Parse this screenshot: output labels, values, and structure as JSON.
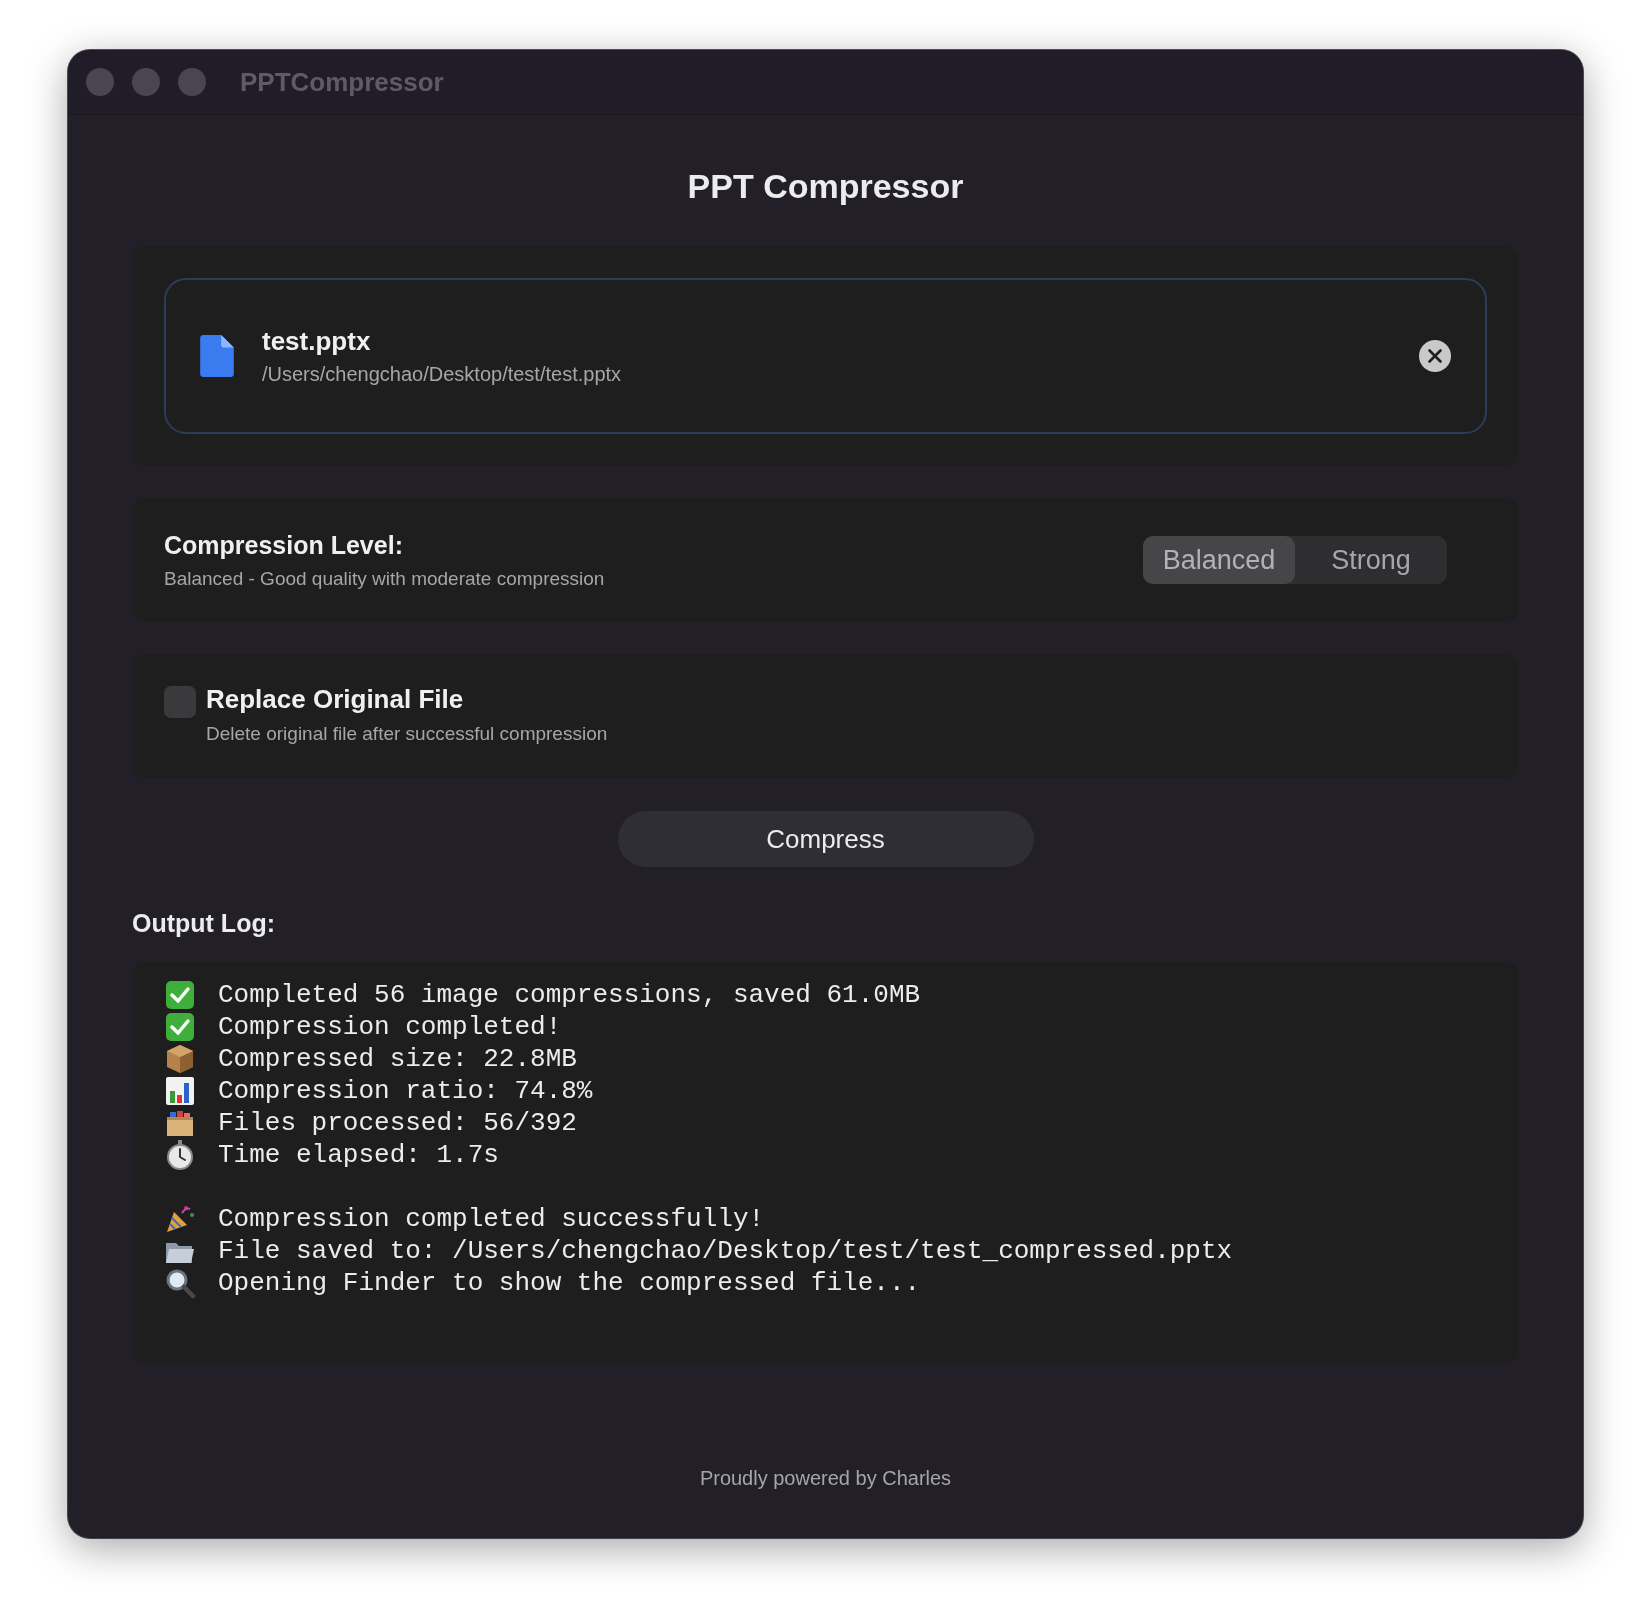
{
  "window": {
    "title": "PPTCompressor"
  },
  "heading": "PPT Compressor",
  "file": {
    "name": "test.pptx",
    "path": "/Users/chengchao/Desktop/test/test.pptx"
  },
  "compression": {
    "label": "Compression Level:",
    "description": "Balanced - Good quality with moderate compression",
    "options": [
      {
        "label": "Balanced",
        "selected": true
      },
      {
        "label": "Strong",
        "selected": false
      }
    ]
  },
  "replace": {
    "label": "Replace Original File",
    "description": "Delete original file after successful compression",
    "checked": false
  },
  "compress_button": "Compress",
  "log": {
    "label": "Output Log:",
    "lines": [
      {
        "kind": "check",
        "text": "Completed 56 image compressions, saved 61.0MB"
      },
      {
        "kind": "check",
        "text": "Compression completed!"
      },
      {
        "kind": "package",
        "text": "Compressed size: 22.8MB"
      },
      {
        "kind": "chart",
        "text": "Compression ratio: 74.8%"
      },
      {
        "kind": "cardbox",
        "text": "Files processed: 56/392"
      },
      {
        "kind": "stopwatch",
        "text": "Time elapsed: 1.7s"
      },
      {
        "kind": "party",
        "text": "Compression completed successfully!",
        "gap_before": true
      },
      {
        "kind": "folder",
        "text": "File saved to: /Users/chengchao/Desktop/test/test_compressed.pptx"
      },
      {
        "kind": "magnifier",
        "text": "Opening Finder to show the compressed file..."
      }
    ]
  },
  "footer": "Proudly powered by Charles"
}
